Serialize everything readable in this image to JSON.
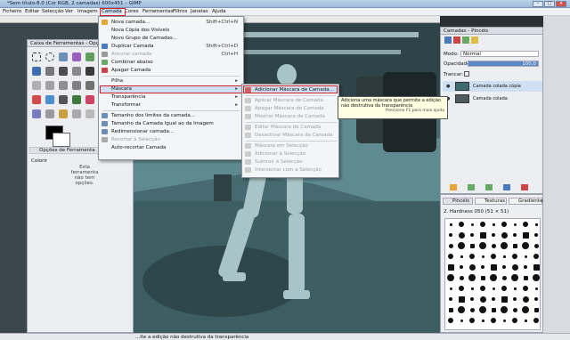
{
  "window": {
    "title": "*Sem título-8.0 (Cor RGB, 2 camadas) 600x451 – GIMP",
    "min": "–",
    "max": "□",
    "close": "✕"
  },
  "menubar": [
    "Ficheiro",
    "Editar",
    "Selecção",
    "Ver",
    "Imagem",
    "Camada",
    "Cores",
    "Ferramentas",
    "Filtros",
    "Janelas",
    "Ajuda"
  ],
  "toolbox": {
    "title": "Caixa de Ferramentas - Opções d...",
    "options_tab": "Opções de Ferramenta",
    "colors_label": "Colorir",
    "info": "Esta ferramenta não tem opções."
  },
  "layers": {
    "title": "Camadas - Pincéis",
    "mode_label": "Modo:",
    "mode_value": "Normal",
    "opacity_label": "Opacidade",
    "opacity_value": "100,0",
    "lock_label": "Trancar:",
    "layer1": "Camada colada cópia",
    "layer2": "Camada colada"
  },
  "brushes": {
    "tabs": [
      "Pincéis",
      "Texturas",
      "Gradientes"
    ],
    "brush_name": "2. Hardness 050 (51 × 51)"
  },
  "menu": {
    "items": [
      {
        "label": "Nova camada...",
        "shortcut": "Shift+Ctrl+N",
        "icon": "new-layer-icon",
        "disabled": false
      },
      {
        "label": "Nova Cópia dos Visíveis",
        "shortcut": "",
        "icon": "",
        "disabled": false
      },
      {
        "label": "Novo Grupo de Camadas...",
        "shortcut": "",
        "icon": "",
        "disabled": false
      },
      {
        "label": "Duplicar Camada",
        "shortcut": "Shift+Ctrl+D",
        "icon": "duplicate-icon",
        "disabled": false
      },
      {
        "label": "Ancorar camada",
        "shortcut": "Ctrl+H",
        "icon": "anchor-icon",
        "disabled": true
      },
      {
        "label": "Combinar abaixo",
        "shortcut": "",
        "icon": "merge-icon",
        "disabled": false
      },
      {
        "label": "Apagar Camada",
        "shortcut": "",
        "icon": "delete-icon",
        "disabled": false
      },
      {
        "label": "Pilha",
        "shortcut": "",
        "icon": "",
        "disabled": false,
        "sub": true
      },
      {
        "label": "Máscara",
        "shortcut": "",
        "icon": "",
        "disabled": false,
        "sub": true,
        "active": true
      },
      {
        "label": "Transparência",
        "shortcut": "",
        "icon": "",
        "disabled": false,
        "sub": true
      },
      {
        "label": "Transformar",
        "shortcut": "",
        "icon": "",
        "disabled": false,
        "sub": true
      },
      {
        "label": "Tamanho dos limites da camada...",
        "shortcut": "",
        "icon": "resize-icon",
        "disabled": false
      },
      {
        "label": "Tamanho da Camada Igual ao da Imagem",
        "shortcut": "",
        "icon": "fit-icon",
        "disabled": false
      },
      {
        "label": "Redimensionar camada...",
        "shortcut": "",
        "icon": "scale-icon",
        "disabled": false
      },
      {
        "label": "Recortar à Selecção",
        "shortcut": "",
        "icon": "crop-icon",
        "disabled": true
      },
      {
        "label": "Auto-recortar Camada",
        "shortcut": "",
        "icon": "",
        "disabled": false
      }
    ]
  },
  "submenu": {
    "items": [
      {
        "label": "Adicionar Máscara de Camada...",
        "disabled": false,
        "active": true
      },
      {
        "label": "Aplicar Máscara de Camada",
        "disabled": true
      },
      {
        "label": "Apagar Máscara de Camada",
        "disabled": true
      },
      {
        "label": "Mostrar Máscara de Camada",
        "disabled": true
      },
      {
        "label": "Editar Máscara de Camada",
        "disabled": true
      },
      {
        "label": "Desactivar Máscara de Camada",
        "disabled": true
      },
      {
        "label": "Máscara em Selecção",
        "disabled": true
      },
      {
        "label": "Adicionar à Selecção",
        "disabled": true
      },
      {
        "label": "Subtrair à Selecção",
        "disabled": true
      },
      {
        "label": "Intersectar com a Selecção",
        "disabled": true
      }
    ]
  },
  "tooltip": {
    "line1": "Adiciona uma máscara que permite a edição",
    "line2": "não destrutiva da transparência",
    "hint": "Pressione F1 para mais ajuda"
  },
  "status": "...ite a edição não destrutiva da transparência"
}
